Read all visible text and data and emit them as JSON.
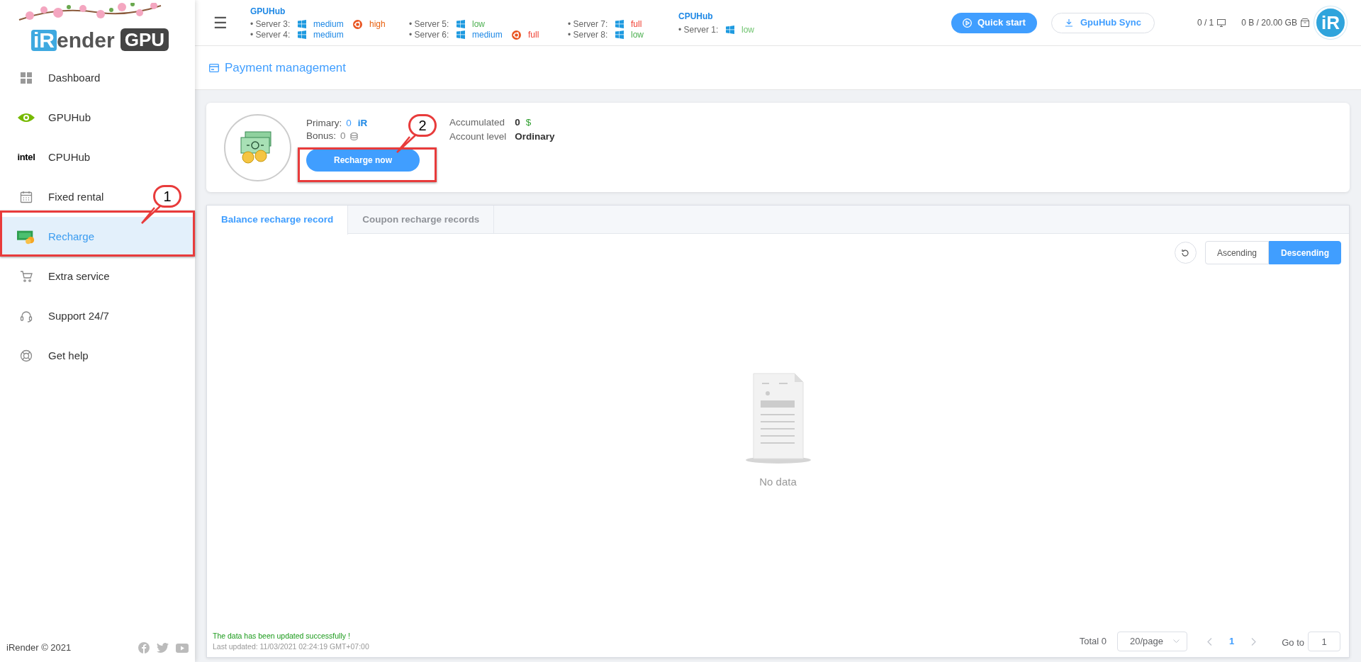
{
  "logo": {
    "prefix": "iR",
    "rest": "ender",
    "badge": "GPU"
  },
  "sidebar": {
    "items": [
      {
        "label": "Dashboard",
        "selected": false
      },
      {
        "label": "GPUHub",
        "selected": false
      },
      {
        "label": "CPUHub",
        "selected": false,
        "icon_text": "intel"
      },
      {
        "label": "Fixed rental",
        "selected": false
      },
      {
        "label": "Recharge",
        "selected": true
      },
      {
        "label": "Extra service",
        "selected": false
      },
      {
        "label": "Support 24/7",
        "selected": false
      },
      {
        "label": "Get help",
        "selected": false
      }
    ],
    "footer": "iRender © 2021"
  },
  "header": {
    "menu_glyph": "☰",
    "gpuhub": {
      "title": "GPUHub",
      "columns": [
        [
          {
            "name": "• Server 3:",
            "entries": [
              {
                "kind": "windows",
                "status": "medium",
                "color": "#1e88e5"
              },
              {
                "kind": "ubuntu",
                "status": "high",
                "color": "#e8600e"
              }
            ]
          },
          {
            "name": "• Server 4:",
            "entries": [
              {
                "kind": "windows",
                "status": "medium",
                "color": "#1e88e5"
              }
            ]
          }
        ],
        [
          {
            "name": "• Server 5:",
            "entries": [
              {
                "kind": "windows",
                "status": "low",
                "color": "#4caf50"
              }
            ]
          },
          {
            "name": "• Server 6:",
            "entries": [
              {
                "kind": "windows",
                "status": "medium",
                "color": "#1e88e5"
              },
              {
                "kind": "ubuntu",
                "status": "full",
                "color": "#f03c2e"
              }
            ]
          }
        ],
        [
          {
            "name": "• Server 7:",
            "entries": [
              {
                "kind": "windows",
                "status": "full",
                "color": "#f03c2e"
              }
            ]
          },
          {
            "name": "• Server 8:",
            "entries": [
              {
                "kind": "windows",
                "status": "low",
                "color": "#4caf50"
              }
            ]
          }
        ]
      ]
    },
    "cpuhub": {
      "title": "CPUHub",
      "columns": [
        [
          {
            "name": "• Server 1:",
            "entries": [
              {
                "kind": "windows",
                "status": "low",
                "color": "#6fc36f"
              }
            ]
          }
        ]
      ]
    },
    "quick_start": "Quick start",
    "sync": "GpuHub Sync",
    "machines": "0 / 1",
    "storage": "0 B / 20.00 GB",
    "avatar": "iR"
  },
  "page_title": "Payment management",
  "account": {
    "primary_label": "Primary:",
    "primary_value": "0",
    "primary_unit": "iR",
    "bonus_label": "Bonus:",
    "bonus_value": "0",
    "recharge_button": "Recharge now",
    "accumulated_label": "Accumulated",
    "accumulated_value": "0",
    "accumulated_unit": "$",
    "level_label": "Account level",
    "level_value": "Ordinary"
  },
  "tabs": [
    {
      "label": "Balance recharge record",
      "selected": true
    },
    {
      "label": "Coupon recharge records",
      "selected": false
    }
  ],
  "sort": [
    {
      "label": "Ascending",
      "selected": false
    },
    {
      "label": "Descending",
      "selected": true
    }
  ],
  "empty_text": "No data",
  "status": {
    "message": "The data has been updated successfully !",
    "updated": "Last updated: 11/03/2021 02:24:19 GMT+07:00"
  },
  "pagination": {
    "total": "Total 0",
    "page_size": "20/page",
    "pages": [
      {
        "label": "1",
        "selected": true
      }
    ],
    "goto_label": "Go to",
    "goto_value": "1"
  },
  "callouts": [
    {
      "label": "1"
    },
    {
      "label": "2"
    }
  ]
}
